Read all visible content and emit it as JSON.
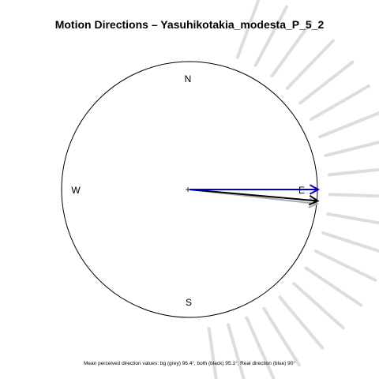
{
  "chart_data": {
    "type": "polar-arrows",
    "title": "Motion Directions – Yasuhikotakia_modesta_P_5_2",
    "compass": {
      "north": "N",
      "east": "E",
      "south": "S",
      "west": "W"
    },
    "background_rays_deg": [
      20,
      28,
      36,
      44,
      52,
      60,
      68,
      76,
      84,
      92,
      100,
      108,
      116,
      124,
      132,
      140,
      148,
      156,
      164,
      172
    ],
    "arrows": [
      {
        "name": "bg",
        "direction_deg": 96.4,
        "color": "#aaaaaa"
      },
      {
        "name": "both",
        "direction_deg": 95.1,
        "color": "#000000"
      },
      {
        "name": "real",
        "direction_deg": 90,
        "color": "#0000cc"
      }
    ],
    "caption": "Mean perceived direction values: bg (grey) 96.4°, both (black) 95.1°; Real direction (blue) 90°",
    "colors": {
      "ray": "#dddddd",
      "circle": "#000000"
    }
  }
}
